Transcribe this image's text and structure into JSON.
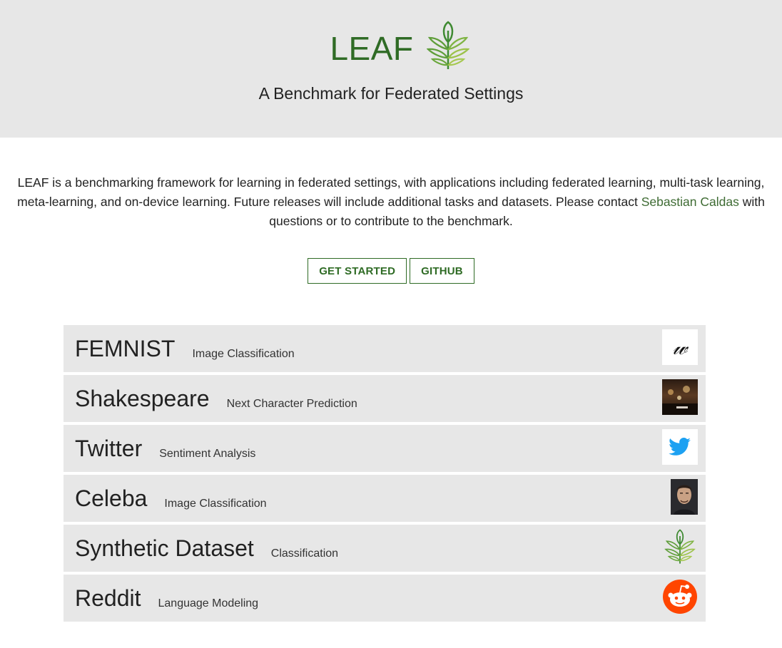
{
  "header": {
    "title": "LEAF",
    "tagline": "A Benchmark for Federated Settings",
    "logo_icon": "leaf-icon"
  },
  "intro": {
    "text_before": "LEAF is a benchmarking framework for learning in federated settings, with applications including federated learning, multi-task learning, meta-learning, and on-device learning. Future releases will include additional tasks and datasets. Please contact ",
    "contact_link": "Sebastian Caldas",
    "text_after": " with questions or to contribute to the benchmark."
  },
  "buttons": {
    "get_started": "GET STARTED",
    "github": "GITHUB"
  },
  "datasets": [
    {
      "name": "FEMNIST",
      "task": "Image Classification",
      "icon": "handwriting-icon"
    },
    {
      "name": "Shakespeare",
      "task": "Next Character Prediction",
      "icon": "theater-icon"
    },
    {
      "name": "Twitter",
      "task": "Sentiment Analysis",
      "icon": "twitter-icon"
    },
    {
      "name": "Celeba",
      "task": "Image Classification",
      "icon": "portrait-icon"
    },
    {
      "name": "Synthetic Dataset",
      "task": "Classification",
      "icon": "leaf-icon"
    },
    {
      "name": "Reddit",
      "task": "Language Modeling",
      "icon": "reddit-icon"
    }
  ],
  "colors": {
    "brand_green": "#2f6b25",
    "link_green": "#3e6b33",
    "panel_gray": "#e7e7e7",
    "twitter_blue": "#1da1f2",
    "reddit_orange": "#ff4500"
  }
}
